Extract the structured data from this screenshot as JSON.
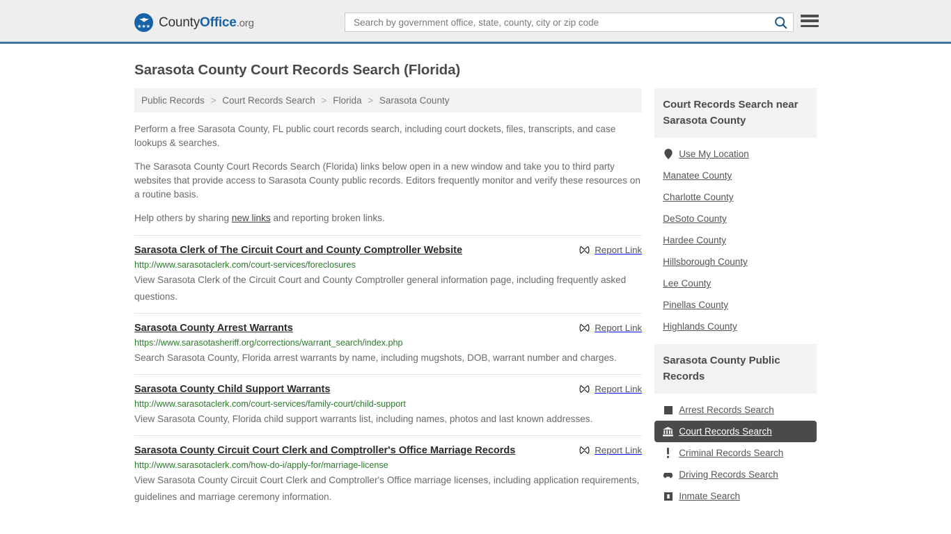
{
  "header": {
    "logo": {
      "text_1": "County",
      "text_2": "Office",
      "text_3": ".org",
      "mark_icon": "eagle-seal-icon"
    },
    "search": {
      "placeholder": "Search by government office, state, county, city or zip code",
      "value": "",
      "button_icon": "search-icon"
    },
    "menu_icon": "hamburger-menu-icon"
  },
  "page_title": "Sarasota County Court Records Search (Florida)",
  "breadcrumb": {
    "separator": ">",
    "items": [
      "Public Records",
      "Court Records Search",
      "Florida",
      "Sarasota County"
    ]
  },
  "intro": {
    "p1": "Perform a free Sarasota County, FL public court records search, including court dockets, files, transcripts, and case lookups & searches.",
    "p2": "The Sarasota County Court Records Search (Florida) links below open in a new window and take you to third party websites that provide access to Sarasota County public records. Editors frequently monitor and verify these resources on a routine basis.",
    "p3_before": "Help others by sharing ",
    "p3_link": "new links",
    "p3_after": " and reporting broken links."
  },
  "report_link_label": "Report Link",
  "report_link_icon": "broken-link-icon",
  "results": [
    {
      "title": "Sarasota Clerk of The Circuit Court and County Comptroller Website",
      "url": "http://www.sarasotaclerk.com/court-services/foreclosures",
      "description": "View Sarasota Clerk of the Circuit Court and County Comptroller general information page, including frequently asked questions."
    },
    {
      "title": "Sarasota County Arrest Warrants",
      "url": "https://www.sarasotasheriff.org/corrections/warrant_search/index.php",
      "description": "Search Sarasota County, Florida arrest warrants by name, including mugshots, DOB, warrant number and charges."
    },
    {
      "title": "Sarasota County Child Support Warrants",
      "url": "http://www.sarasotaclerk.com/court-services/family-court/child-support",
      "description": "View Sarasota County, Florida child support warrants list, including names, photos and last known addresses."
    },
    {
      "title": "Sarasota County Circuit Court Clerk and Comptroller's Office Marriage Records",
      "url": "http://www.sarasotaclerk.com/how-do-i/apply-for/marriage-license",
      "description": "View Sarasota County Circuit Court Clerk and Comptroller's Office marriage licenses, including application requirements, guidelines and marriage ceremony information."
    }
  ],
  "sidebar": {
    "near_panel": {
      "heading": "Court Records Search near Sarasota County",
      "items": [
        {
          "label": "Use My Location",
          "icon": "map-pin-icon",
          "active": false
        },
        {
          "label": "Manatee County",
          "icon": "",
          "active": false
        },
        {
          "label": "Charlotte County",
          "icon": "",
          "active": false
        },
        {
          "label": "DeSoto County",
          "icon": "",
          "active": false
        },
        {
          "label": "Hardee County",
          "icon": "",
          "active": false
        },
        {
          "label": "Hillsborough County",
          "icon": "",
          "active": false
        },
        {
          "label": "Lee County",
          "icon": "",
          "active": false
        },
        {
          "label": "Pinellas County",
          "icon": "",
          "active": false
        },
        {
          "label": "Highlands County",
          "icon": "",
          "active": false
        }
      ]
    },
    "records_panel": {
      "heading": "Sarasota County Public Records",
      "items": [
        {
          "label": "Arrest Records Search",
          "icon": "fingerprint-icon",
          "active": false
        },
        {
          "label": "Court Records Search",
          "icon": "courthouse-icon",
          "active": true
        },
        {
          "label": "Criminal Records Search",
          "icon": "exclamation-icon",
          "active": false
        },
        {
          "label": "Driving Records Search",
          "icon": "car-icon",
          "active": false
        },
        {
          "label": "Inmate Search",
          "icon": "jail-bed-icon",
          "active": false
        }
      ]
    }
  },
  "colors": {
    "accent_blue": "#1763a8",
    "header_bg": "#eeeeee",
    "header_border": "#3c76a8",
    "url_green": "#2d7a2d",
    "panel_bg": "#f2f2f2",
    "active_bg": "#4a4a4a",
    "body_text": "#6a6a6a"
  }
}
